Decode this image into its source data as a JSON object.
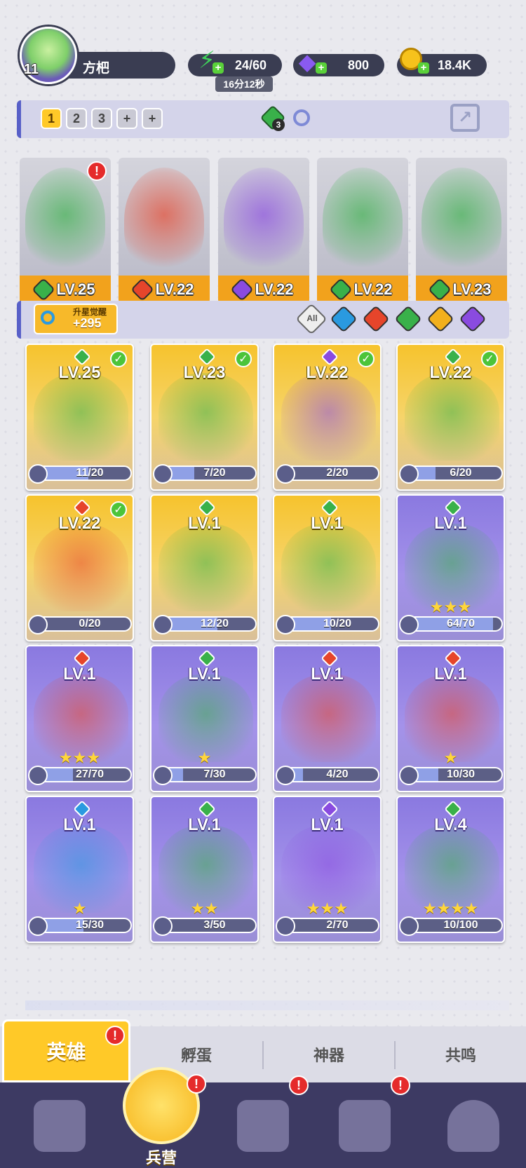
{
  "player": {
    "level": "11",
    "name": "方杷"
  },
  "resources": {
    "energy": "24/60",
    "energy_timer": "16分12秒",
    "gems": "800",
    "gold": "18.4K"
  },
  "team_bar": {
    "slots": [
      "1",
      "2",
      "3",
      "+",
      "+"
    ],
    "token_count": "3"
  },
  "team": [
    {
      "lv": "LV.25",
      "element": "green",
      "color": "#39b14a",
      "badge": "!"
    },
    {
      "lv": "LV.22",
      "element": "red",
      "color": "#e6452b"
    },
    {
      "lv": "LV.22",
      "element": "purple",
      "color": "#8a4be0"
    },
    {
      "lv": "LV.22",
      "element": "green",
      "color": "#39b14a"
    },
    {
      "lv": "LV.23",
      "element": "green",
      "color": "#39b14a"
    }
  ],
  "filter_bar": {
    "awaken_label": "升星觉醒",
    "awaken_value": "+295",
    "all_label": "All"
  },
  "heroes": [
    {
      "lv": "LV.25",
      "progress": "11/20",
      "fill": 0.55,
      "rarity": "gold",
      "element_color": "#39b14a",
      "checked": true,
      "stars": ""
    },
    {
      "lv": "LV.23",
      "progress": "7/20",
      "fill": 0.35,
      "rarity": "gold",
      "element_color": "#39b14a",
      "checked": true,
      "stars": ""
    },
    {
      "lv": "LV.22",
      "progress": "2/20",
      "fill": 0.1,
      "rarity": "gold",
      "element_color": "#8a4be0",
      "checked": true,
      "stars": ""
    },
    {
      "lv": "LV.22",
      "progress": "6/20",
      "fill": 0.3,
      "rarity": "gold",
      "element_color": "#39b14a",
      "checked": true,
      "stars": ""
    },
    {
      "lv": "LV.22",
      "progress": "0/20",
      "fill": 0,
      "rarity": "gold",
      "element_color": "#e6452b",
      "checked": true,
      "stars": ""
    },
    {
      "lv": "LV.1",
      "progress": "12/20",
      "fill": 0.6,
      "rarity": "gold",
      "element_color": "#39b14a",
      "checked": false,
      "stars": ""
    },
    {
      "lv": "LV.1",
      "progress": "10/20",
      "fill": 0.5,
      "rarity": "gold",
      "element_color": "#39b14a",
      "checked": false,
      "stars": ""
    },
    {
      "lv": "LV.1",
      "progress": "64/70",
      "fill": 0.91,
      "rarity": "purple",
      "element_color": "#39b14a",
      "checked": false,
      "stars": "★★★"
    },
    {
      "lv": "LV.1",
      "progress": "27/70",
      "fill": 0.39,
      "rarity": "purple",
      "element_color": "#e6452b",
      "checked": false,
      "stars": "★★★"
    },
    {
      "lv": "LV.1",
      "progress": "7/30",
      "fill": 0.23,
      "rarity": "purple",
      "element_color": "#39b14a",
      "checked": false,
      "stars": "★"
    },
    {
      "lv": "LV.1",
      "progress": "4/20",
      "fill": 0.2,
      "rarity": "purple",
      "element_color": "#e6452b",
      "checked": false,
      "stars": ""
    },
    {
      "lv": "LV.1",
      "progress": "10/30",
      "fill": 0.33,
      "rarity": "purple",
      "element_color": "#e6452b",
      "checked": false,
      "stars": "★"
    },
    {
      "lv": "LV.1",
      "progress": "15/30",
      "fill": 0.5,
      "rarity": "purple",
      "element_color": "#2a9ae0",
      "checked": false,
      "stars": "★"
    },
    {
      "lv": "LV.1",
      "progress": "3/50",
      "fill": 0.06,
      "rarity": "purple",
      "element_color": "#39b14a",
      "checked": false,
      "stars": "★★"
    },
    {
      "lv": "LV.1",
      "progress": "2/70",
      "fill": 0.03,
      "rarity": "purple",
      "element_color": "#8a4be0",
      "checked": false,
      "stars": "★★★"
    },
    {
      "lv": "LV.4",
      "progress": "10/100",
      "fill": 0.1,
      "rarity": "purple",
      "element_color": "#39b14a",
      "checked": false,
      "stars": "★★★★"
    }
  ],
  "subtabs": {
    "hero": "英雄",
    "egg": "孵蛋",
    "artifact": "神器",
    "resonance": "共鸣"
  },
  "nav": {
    "barracks": "兵营"
  },
  "badge": "!"
}
